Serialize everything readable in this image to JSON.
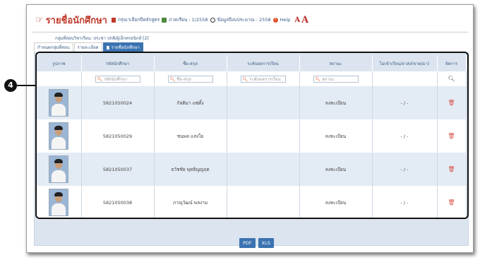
{
  "header": {
    "title": "รายชื่อนักศึกษา",
    "select_course": "กรุณาเลือกปีหลักสูตร",
    "semester": "ภาคเรียน : 1/2558",
    "data_year": "ข้อมูลปีงบประมาณ : 2558",
    "help": "Help",
    "font_small": "A",
    "font_large": "A"
  },
  "breadcrumb": "กลุ่มที่สอนวิชาเรียน: ประชา ปกติ/ผู้เล็กทรอนิกส์ [2]",
  "tabs": [
    {
      "label": "กำหนดกลุ่มที่สอน"
    },
    {
      "label": "รายละเอียด"
    },
    {
      "label": "รายชื่อนักศึกษา"
    }
  ],
  "table": {
    "columns": [
      "รูปภาพ",
      "รหัสนักศึกษา",
      "ชื่อ-สกุล",
      "ระดับผลการเรียน",
      "สถานะ",
      "ไม่เข้าเรียน/ลาส่ง(ขาด/มา)",
      "จัดการ"
    ],
    "filters": {
      "student_id": "รหัสนักศึกษา",
      "name": "ชื่อ-สกุล",
      "grade": "ระดับผลการเรียน",
      "status": "สถานะ"
    },
    "rows": [
      {
        "id": "5821050024",
        "name": "กัลติมา แซ่ตั้ง",
        "grade": "",
        "status": "ลงทะเบียน",
        "absence": "- / -"
      },
      {
        "id": "5821050029",
        "name": "ชนพล แสงใย",
        "grade": "",
        "status": "ลงทะเบียน",
        "absence": "- / -"
      },
      {
        "id": "5821050037",
        "name": "ธวัชชัย พุทธิญญฤต",
        "grade": "",
        "status": "ลงทะเบียน",
        "absence": "- / -"
      },
      {
        "id": "5821050038",
        "name": "ภาณุวัฒน์ พลงาม",
        "grade": "",
        "status": "ลงทะเบียน",
        "absence": "- / -"
      }
    ]
  },
  "callout": "4",
  "buttons": {
    "pdf": "PDF",
    "xls": "XLS"
  }
}
